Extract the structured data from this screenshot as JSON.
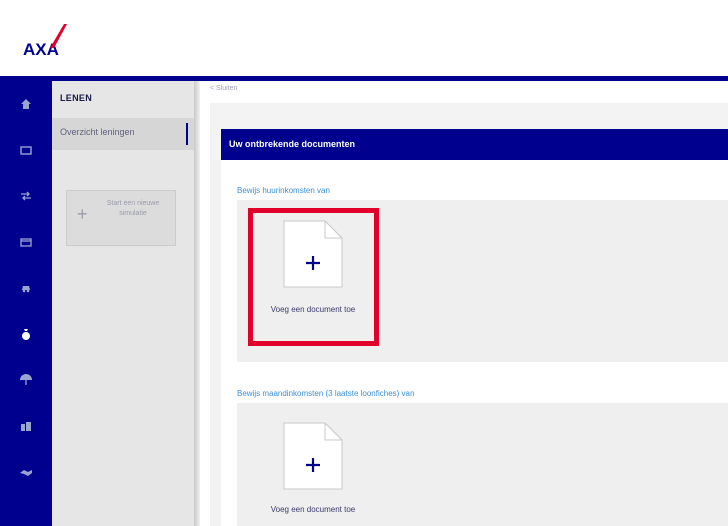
{
  "header": {
    "logo_text": "AXA"
  },
  "rail": {
    "items": [
      "home-icon",
      "folder-icon",
      "transfer-icon",
      "card-icon",
      "car-icon",
      "money-bag-icon",
      "umbrella-icon",
      "building-icon",
      "handshake-icon"
    ]
  },
  "subnav": {
    "title": "LENEN",
    "active_item": "Overzicht leningen",
    "simulation_label": "Start een nieuwe simulatie"
  },
  "breadcrumb": "< Sluiten",
  "main": {
    "section_title": "Uw ontbrekende documenten",
    "groups": [
      {
        "title": "Bewijs huurinkomsten van",
        "add_label": "Voeg een document toe"
      },
      {
        "title": "Bewijs maandinkomsten (3 laatste loonfiches) van",
        "add_label": "Voeg een document toe"
      }
    ]
  },
  "colors": {
    "brand_blue": "#00008f",
    "brand_red": "#e0002a",
    "link_blue": "#3d8fd6"
  }
}
